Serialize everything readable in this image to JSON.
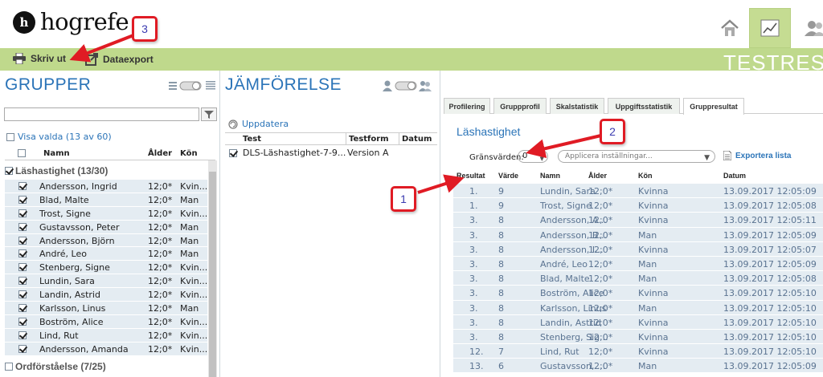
{
  "header": {
    "logo_mark": "h",
    "logo_text": "hogrefe",
    "nav_icons": [
      "home-icon",
      "chart-icon",
      "users-icon"
    ]
  },
  "toolbar": {
    "print_label": "Skriv ut",
    "export_label": "Dataexport",
    "page_heading": "TESTRESU"
  },
  "groups": {
    "title": "GRUPPER",
    "search_value": "",
    "show_selected": "Visa valda (13 av 60)",
    "columns": {
      "name": "Namn",
      "age": "Ålder",
      "gender": "Kön"
    },
    "group1": "Läshastighet (13/30)",
    "group2": "Ordförståelse (7/25)",
    "members": [
      {
        "name": "Andersson, Ingrid",
        "age": "12;0*",
        "gender": "Kvin..."
      },
      {
        "name": "Blad, Malte",
        "age": "12;0*",
        "gender": "Man"
      },
      {
        "name": "Trost, Signe",
        "age": "12;0*",
        "gender": "Kvin..."
      },
      {
        "name": "Gustavsson, Peter",
        "age": "12;0*",
        "gender": "Man"
      },
      {
        "name": "Andersson, Björn",
        "age": "12;0*",
        "gender": "Man"
      },
      {
        "name": "André, Leo",
        "age": "12;0*",
        "gender": "Man"
      },
      {
        "name": "Stenberg, Signe",
        "age": "12;0*",
        "gender": "Kvin..."
      },
      {
        "name": "Lundin, Sara",
        "age": "12;0*",
        "gender": "Kvin..."
      },
      {
        "name": "Landin, Astrid",
        "age": "12;0*",
        "gender": "Kvin..."
      },
      {
        "name": "Karlsson, Linus",
        "age": "12;0*",
        "gender": "Man"
      },
      {
        "name": "Boström, Alice",
        "age": "12;0*",
        "gender": "Kvin..."
      },
      {
        "name": "Lind, Rut",
        "age": "12;0*",
        "gender": "Kvin..."
      },
      {
        "name": "Andersson, Amanda",
        "age": "12;0*",
        "gender": "Kvin..."
      }
    ]
  },
  "comparison": {
    "title": "JÄMFÖRELSE",
    "update_label": "Uppdatera",
    "columns": {
      "test": "Test",
      "form": "Testform",
      "date": "Datum"
    },
    "row": {
      "test": "DLS-Läshastighet-7-9...",
      "form": "Version A",
      "date": ""
    }
  },
  "results": {
    "tabs": [
      "Profilering",
      "Gruppprofil",
      "Skalstatistik",
      "Uppgiftsstatistik",
      "Gruppresultat"
    ],
    "active_tab": "Gruppresultat",
    "title": "Läshastighet",
    "threshold_label": "Gränsvärden:",
    "threshold_value": "0",
    "settings_placeholder": "Applicera inställningar...",
    "export_list_label": "Exportera lista",
    "columns": {
      "result": "Resultat",
      "value": "Värde",
      "name": "Namn",
      "age": "Ålder",
      "gender": "Kön",
      "date": "Datum"
    },
    "rows": [
      {
        "result": "1.",
        "value": "9",
        "name": "Lundin, Sara",
        "age": "12;0*",
        "gender": "Kvinna",
        "date": "13.09.2017 12:05:09"
      },
      {
        "result": "1.",
        "value": "9",
        "name": "Trost, Signe",
        "age": "12;0*",
        "gender": "Kvinna",
        "date": "13.09.2017 12:05:08"
      },
      {
        "result": "3.",
        "value": "8",
        "name": "Andersson, A...",
        "age": "12;0*",
        "gender": "Kvinna",
        "date": "13.09.2017 12:05:11"
      },
      {
        "result": "3.",
        "value": "8",
        "name": "Andersson, B...",
        "age": "12;0*",
        "gender": "Man",
        "date": "13.09.2017 12:05:09"
      },
      {
        "result": "3.",
        "value": "8",
        "name": "Andersson, I...",
        "age": "12;0*",
        "gender": "Kvinna",
        "date": "13.09.2017 12:05:07"
      },
      {
        "result": "3.",
        "value": "8",
        "name": "André, Leo",
        "age": "12;0*",
        "gender": "Man",
        "date": "13.09.2017 12:05:09"
      },
      {
        "result": "3.",
        "value": "8",
        "name": "Blad, Malte",
        "age": "12;0*",
        "gender": "Man",
        "date": "13.09.2017 12:05:08"
      },
      {
        "result": "3.",
        "value": "8",
        "name": "Boström, Alice",
        "age": "12;0*",
        "gender": "Kvinna",
        "date": "13.09.2017 12:05:10"
      },
      {
        "result": "3.",
        "value": "8",
        "name": "Karlsson, Linus",
        "age": "12;0*",
        "gender": "Man",
        "date": "13.09.2017 12:05:10"
      },
      {
        "result": "3.",
        "value": "8",
        "name": "Landin, Astrid",
        "age": "12;0*",
        "gender": "Kvinna",
        "date": "13.09.2017 12:05:10"
      },
      {
        "result": "3.",
        "value": "8",
        "name": "Stenberg, Sig...",
        "age": "12;0*",
        "gender": "Kvinna",
        "date": "13.09.2017 12:05:10"
      },
      {
        "result": "12.",
        "value": "7",
        "name": "Lind, Rut",
        "age": "12;0*",
        "gender": "Kvinna",
        "date": "13.09.2017 12:05:10"
      },
      {
        "result": "13.",
        "value": "6",
        "name": "Gustavsson, ...",
        "age": "12;0*",
        "gender": "Man",
        "date": "13.09.2017 12:05:09"
      }
    ]
  },
  "callouts": {
    "c1": "1",
    "c2": "2",
    "c3": "3"
  },
  "colors": {
    "accent": "#2b74b8",
    "toolbar": "#bfd98c",
    "row": "#e4ecf2",
    "callout": "#e01b24"
  }
}
